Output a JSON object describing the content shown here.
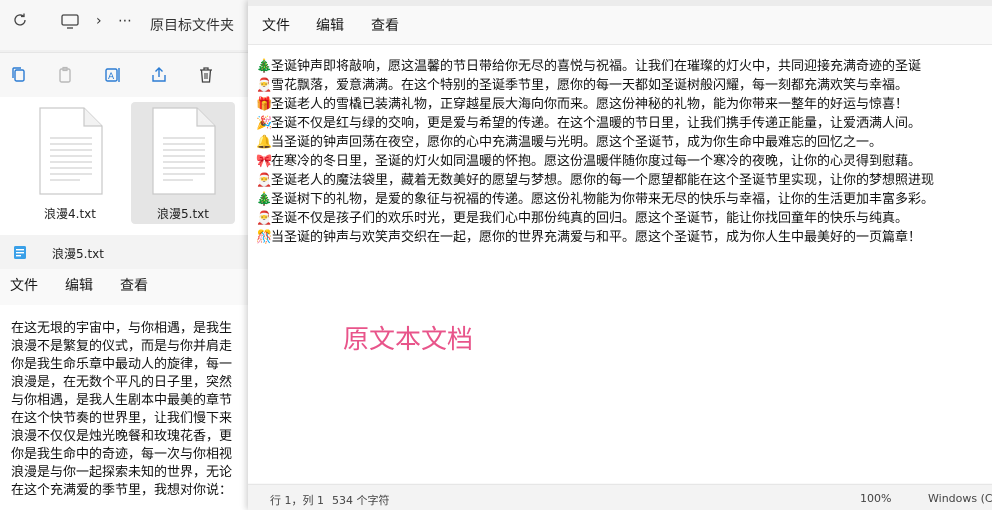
{
  "explorer": {
    "address": {
      "refresh_icon": "refresh-icon",
      "computer_icon": "computer-icon",
      "chevron": "›",
      "ellipsis": "⋯",
      "folder": "原目标文件夹"
    },
    "files": [
      {
        "name": "浪漫4.txt"
      },
      {
        "name": "浪漫5.txt"
      }
    ]
  },
  "left_notepad": {
    "title": "浪漫5.txt",
    "menu": [
      "文件",
      "编辑",
      "查看"
    ],
    "lines": [
      "在这无垠的宇宙中，与你相遇，是我生",
      "浪漫不是繁复的仪式，而是与你并肩走",
      "你是我生命乐章中最动人的旋律，每一",
      "浪漫是，在无数个平凡的日子里，突然",
      "与你相遇，是我人生剧本中最美的章节",
      "在这个快节奏的世界里，让我们慢下来",
      "浪漫不仅仅是烛光晚餐和玫瑰花香，更",
      "你是我生命中的奇迹，每一次与你相视",
      "浪漫是与你一起探索未知的世界，无论",
      "在这个充满爱的季节里，我想对你说："
    ]
  },
  "right_notepad": {
    "menu": [
      "文件",
      "编辑",
      "查看"
    ],
    "lines": [
      {
        "emoji": "🎄",
        "text": "圣诞钟声即将敲响，愿这温馨的节日带给你无尽的喜悦与祝福。让我们在璀璨的灯火中，共同迎接充满奇迹的圣诞"
      },
      {
        "emoji": "🎅",
        "text": "雪花飘落，爱意满满。在这个特别的圣诞季节里，愿你的每一天都如圣诞树般闪耀，每一刻都充满欢笑与幸福。"
      },
      {
        "emoji": "🎁",
        "text": "圣诞老人的雪橇已装满礼物，正穿越星辰大海向你而来。愿这份神秘的礼物，能为你带来一整年的好运与惊喜！"
      },
      {
        "emoji": "🎉",
        "text": "圣诞不仅是红与绿的交响，更是爱与希望的传递。在这个温暖的节日里，让我们携手传递正能量，让爱洒满人间。"
      },
      {
        "emoji": "🔔",
        "text": "当圣诞的钟声回荡在夜空，愿你的心中充满温暖与光明。愿这个圣诞节，成为你生命中最难忘的回忆之一。"
      },
      {
        "emoji": "🎀",
        "text": "在寒冷的冬日里，圣诞的灯火如同温暖的怀抱。愿这份温暖伴随你度过每一个寒冷的夜晚，让你的心灵得到慰藉。"
      },
      {
        "emoji": "🎅",
        "text": "圣诞老人的魔法袋里，藏着无数美好的愿望与梦想。愿你的每一个愿望都能在这个圣诞节里实现，让你的梦想照进现"
      },
      {
        "emoji": "🎄",
        "text": "圣诞树下的礼物，是爱的象征与祝福的传递。愿这份礼物能为你带来无尽的快乐与幸福，让你的生活更加丰富多彩。"
      },
      {
        "emoji": "🎅",
        "text": "圣诞不仅是孩子们的欢乐时光，更是我们心中那份纯真的回归。愿这个圣诞节，能让你找回童年的快乐与纯真。"
      },
      {
        "emoji": "🎊",
        "text": "当圣诞的钟声与欢笑声交织在一起，愿你的世界充满爱与和平。愿这个圣诞节，成为你人生中最美好的一页篇章！"
      }
    ],
    "overlay_label": "原文本文档",
    "status": {
      "position": "行 1，列 1",
      "chars": "534 个字符",
      "zoom": "100%",
      "encoding": "Windows (C"
    }
  }
}
